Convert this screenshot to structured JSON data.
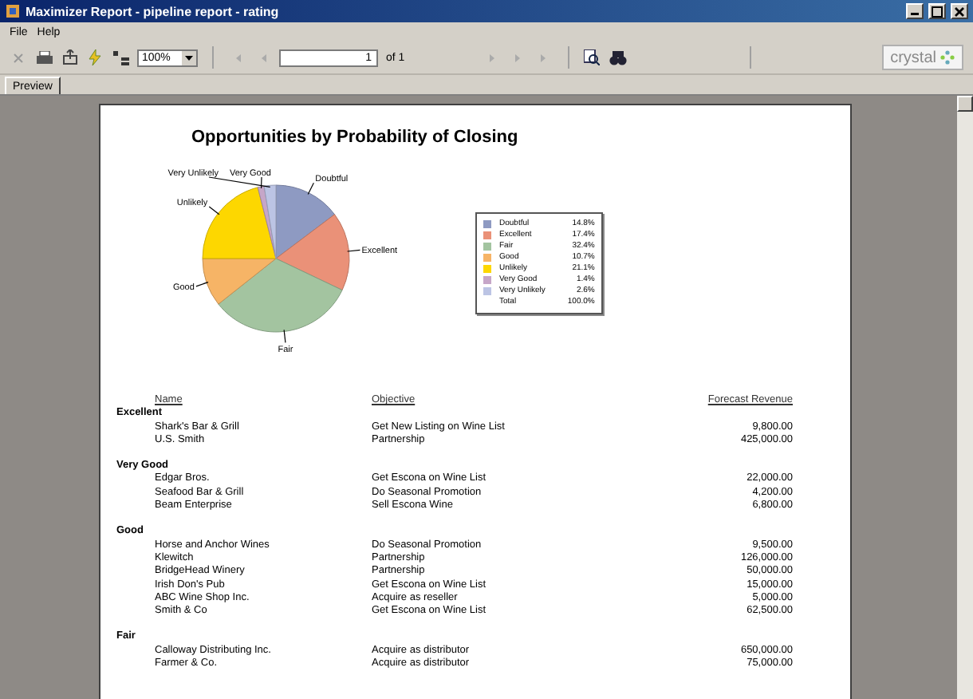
{
  "window": {
    "title": "Maximizer Report - pipeline report - rating"
  },
  "menu": [
    {
      "label": "File"
    },
    {
      "label": "Help"
    }
  ],
  "toolbar": {
    "zoom": "100%",
    "page": "1",
    "page_of": "of 1",
    "brand": "crystal"
  },
  "tabs": [
    {
      "label": "Preview",
      "selected": true
    }
  ],
  "report": {
    "chart": {
      "title": "Opportunities by Probability of Closing",
      "chart_data": {
        "type": "pie",
        "categories": [
          "Doubtful",
          "Excellent",
          "Fair",
          "Good",
          "Unlikely",
          "Very Good",
          "Very Unlikely"
        ],
        "series": [
          {
            "values": [
              14.8,
              17.4,
              32.4,
              10.7,
              21.1,
              1.4,
              2.6
            ]
          }
        ]
      }
    },
    "legend": {
      "items": [
        {
          "label": "Doubtful",
          "value": "14.8%",
          "color": "#8e9ac2"
        },
        {
          "label": "Excellent",
          "value": "17.4%",
          "color": "#ea9178"
        },
        {
          "label": "Fair",
          "value": "32.4%",
          "color": "#a3c4a0"
        },
        {
          "label": "Good",
          "value": "10.7%",
          "color": "#f6b466"
        },
        {
          "label": "Unlikely",
          "value": "21.1%",
          "color": "#fdd700"
        },
        {
          "label": "Very Good",
          "value": "1.4%",
          "color": "#c6a6c8"
        },
        {
          "label": "Very Unlikely",
          "value": "2.6%",
          "color": "#bcc4e4"
        }
      ],
      "total": {
        "label": "Total",
        "value": "100.0%"
      }
    },
    "columns": [
      "Name",
      "Objective",
      "Forecast Revenue"
    ],
    "groups": [
      {
        "name": "Excellent",
        "rows": [
          {
            "name": "Shark's Bar & Grill",
            "objective": "Get New Listing on Wine List",
            "revenue": "9,800.00"
          },
          {
            "name": "U.S. Smith",
            "objective": "Partnership",
            "revenue": "425,000.00"
          }
        ]
      },
      {
        "name": "Very Good",
        "rows": [
          {
            "name": "Edgar Bros.",
            "objective": "Get Escona on Wine List",
            "revenue": "22,000.00"
          },
          {
            "name": "Seafood Bar & Grill",
            "objective": "Do Seasonal Promotion",
            "revenue": "4,200.00"
          },
          {
            "name": "Beam Enterprise",
            "objective": "Sell Escona Wine",
            "revenue": "6,800.00"
          }
        ]
      },
      {
        "name": "Good",
        "rows": [
          {
            "name": "Horse and Anchor Wines",
            "objective": "Do Seasonal Promotion",
            "revenue": "9,500.00"
          },
          {
            "name": "Klewitch",
            "objective": "Partnership",
            "revenue": "126,000.00"
          },
          {
            "name": "BridgeHead Winery",
            "objective": "Partnership",
            "revenue": "50,000.00"
          },
          {
            "name": "Irish Don's Pub",
            "objective": "Get Escona on Wine List",
            "revenue": "15,000.00"
          },
          {
            "name": "ABC Wine Shop Inc.",
            "objective": "Acquire as reseller",
            "revenue": "5,000.00"
          },
          {
            "name": "Smith & Co",
            "objective": "Get Escona on Wine List",
            "revenue": "62,500.00"
          }
        ]
      },
      {
        "name": "Fair",
        "rows": [
          {
            "name": "Calloway Distributing Inc.",
            "objective": "Acquire as distributor",
            "revenue": "650,000.00"
          },
          {
            "name": "Farmer & Co.",
            "objective": "Acquire as distributor",
            "revenue": "75,000.00"
          }
        ]
      }
    ]
  }
}
